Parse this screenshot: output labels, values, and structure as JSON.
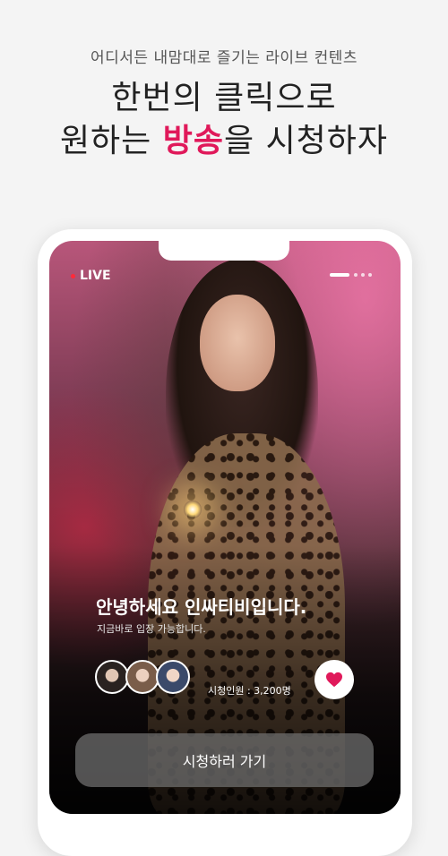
{
  "header": {
    "subtitle": "어디서든 내맘대로 즐기는 라이브 컨텐츠",
    "headline_line1": "한번의 클릭으로",
    "headline_line2_before": "원하는 ",
    "headline_line2_accent": "방송",
    "headline_line2_after": "을 시청하자"
  },
  "colors": {
    "accent": "#e0195a",
    "live_dot": "#ff2a3a",
    "heart": "#e0195a"
  },
  "stream": {
    "live_label": "LIVE",
    "title": "안녕하세요 인싸티비입니다.",
    "description": "지금바로 입장 가능합니다.",
    "viewer_count_text": "시청인원 : 3,200명",
    "watch_button_label": "시청하러 가기",
    "pager": {
      "total_pages": 4,
      "active_index": 0
    }
  },
  "icons": {
    "heart": "heart-icon",
    "live_indicator": "live-dot-icon"
  }
}
